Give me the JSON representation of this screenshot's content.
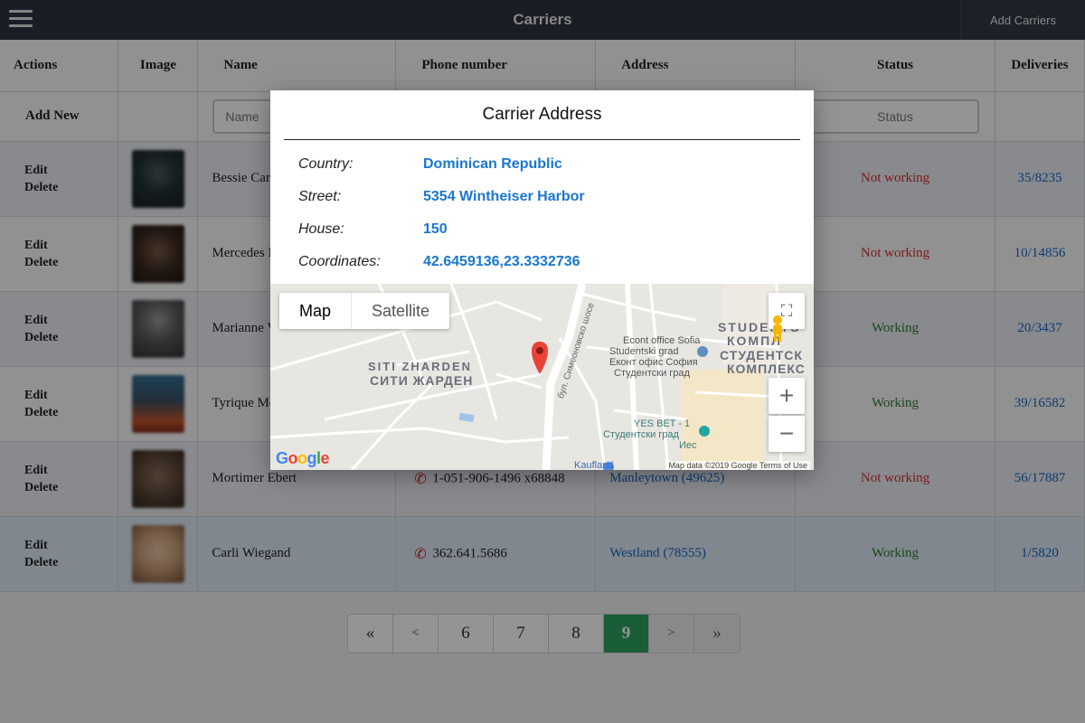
{
  "header": {
    "title": "Carriers",
    "add_button": "Add Carriers"
  },
  "table": {
    "columns": [
      "Actions",
      "Image",
      "Name",
      "Phone number",
      "Address",
      "Status",
      "Deliveries"
    ],
    "add_new": "Add New",
    "filter_name_placeholder": "Name",
    "filter_status_placeholder": "Status",
    "edit_label": "Edit",
    "delete_label": "Delete",
    "rows": [
      {
        "name": "Bessie Car",
        "phone": "",
        "address": "",
        "status": "Not working",
        "deliveries": "35/8235"
      },
      {
        "name": "Mercedes M",
        "phone": "",
        "address": "",
        "status": "Not working",
        "deliveries": "10/14856"
      },
      {
        "name": "Marianne V",
        "phone": "",
        "address": "",
        "status": "Working",
        "deliveries": "20/3437"
      },
      {
        "name": "Tyrique Mo",
        "phone": "",
        "address": "",
        "status": "Working",
        "deliveries": "39/16582"
      },
      {
        "name": "Mortimer Ebert",
        "phone": "1-051-906-1496 x68848",
        "address": "Manleytown (49625)",
        "status": "Not working",
        "deliveries": "56/17887"
      },
      {
        "name": "Carli Wiegand",
        "phone": "362.641.5686",
        "address": "Westland (78555)",
        "status": "Working",
        "deliveries": "1/5820"
      }
    ]
  },
  "pagination": {
    "first": "«",
    "prev": "<",
    "pages": [
      "6",
      "7",
      "8",
      "9"
    ],
    "active": "9",
    "next": ">",
    "last": "»"
  },
  "modal": {
    "title": "Carrier Address",
    "country_label": "Country:",
    "country": "Dominican Republic",
    "street_label": "Street:",
    "street": "5354 Wintheiser Harbor",
    "house_label": "House:",
    "house": "150",
    "coords_label": "Coordinates:",
    "coords": "42.6459136,23.3332736",
    "map": {
      "map_tab": "Map",
      "satellite_tab": "Satellite",
      "label_siti_lat": "SITI ZHARDEN",
      "label_siti_cyr": "СИТИ ЖАРДЕН",
      "label_studs_1": "STUDENTS",
      "label_studs_2": "КОМПЛ",
      "label_studs_3": "СТУДЕНТСК",
      "label_studs_4": "КОМПЛЕКС",
      "poi_econt_1": "Econt office Sofia",
      "poi_econt_2": "Studentski grad",
      "poi_econt_3": "Еконт офис София",
      "poi_econt_4": "Студентски град",
      "poi_yes_1": "YES BET - 1",
      "poi_yes_2": "Студентски град",
      "poi_yes_3": "Иес",
      "poi_kaufland": "Kaufland",
      "road_simeon": "бул. Симеоновско шосе",
      "google": "Google",
      "map_data": "Map data ©2019 Google   Terms of Use"
    }
  },
  "colors": {
    "topbar": "#2b3342",
    "link": "#1976d2",
    "not_working": "#d32f2f",
    "working": "#2e7d32",
    "active_page": "#2ca25f",
    "phone_icon": "#c62828"
  }
}
